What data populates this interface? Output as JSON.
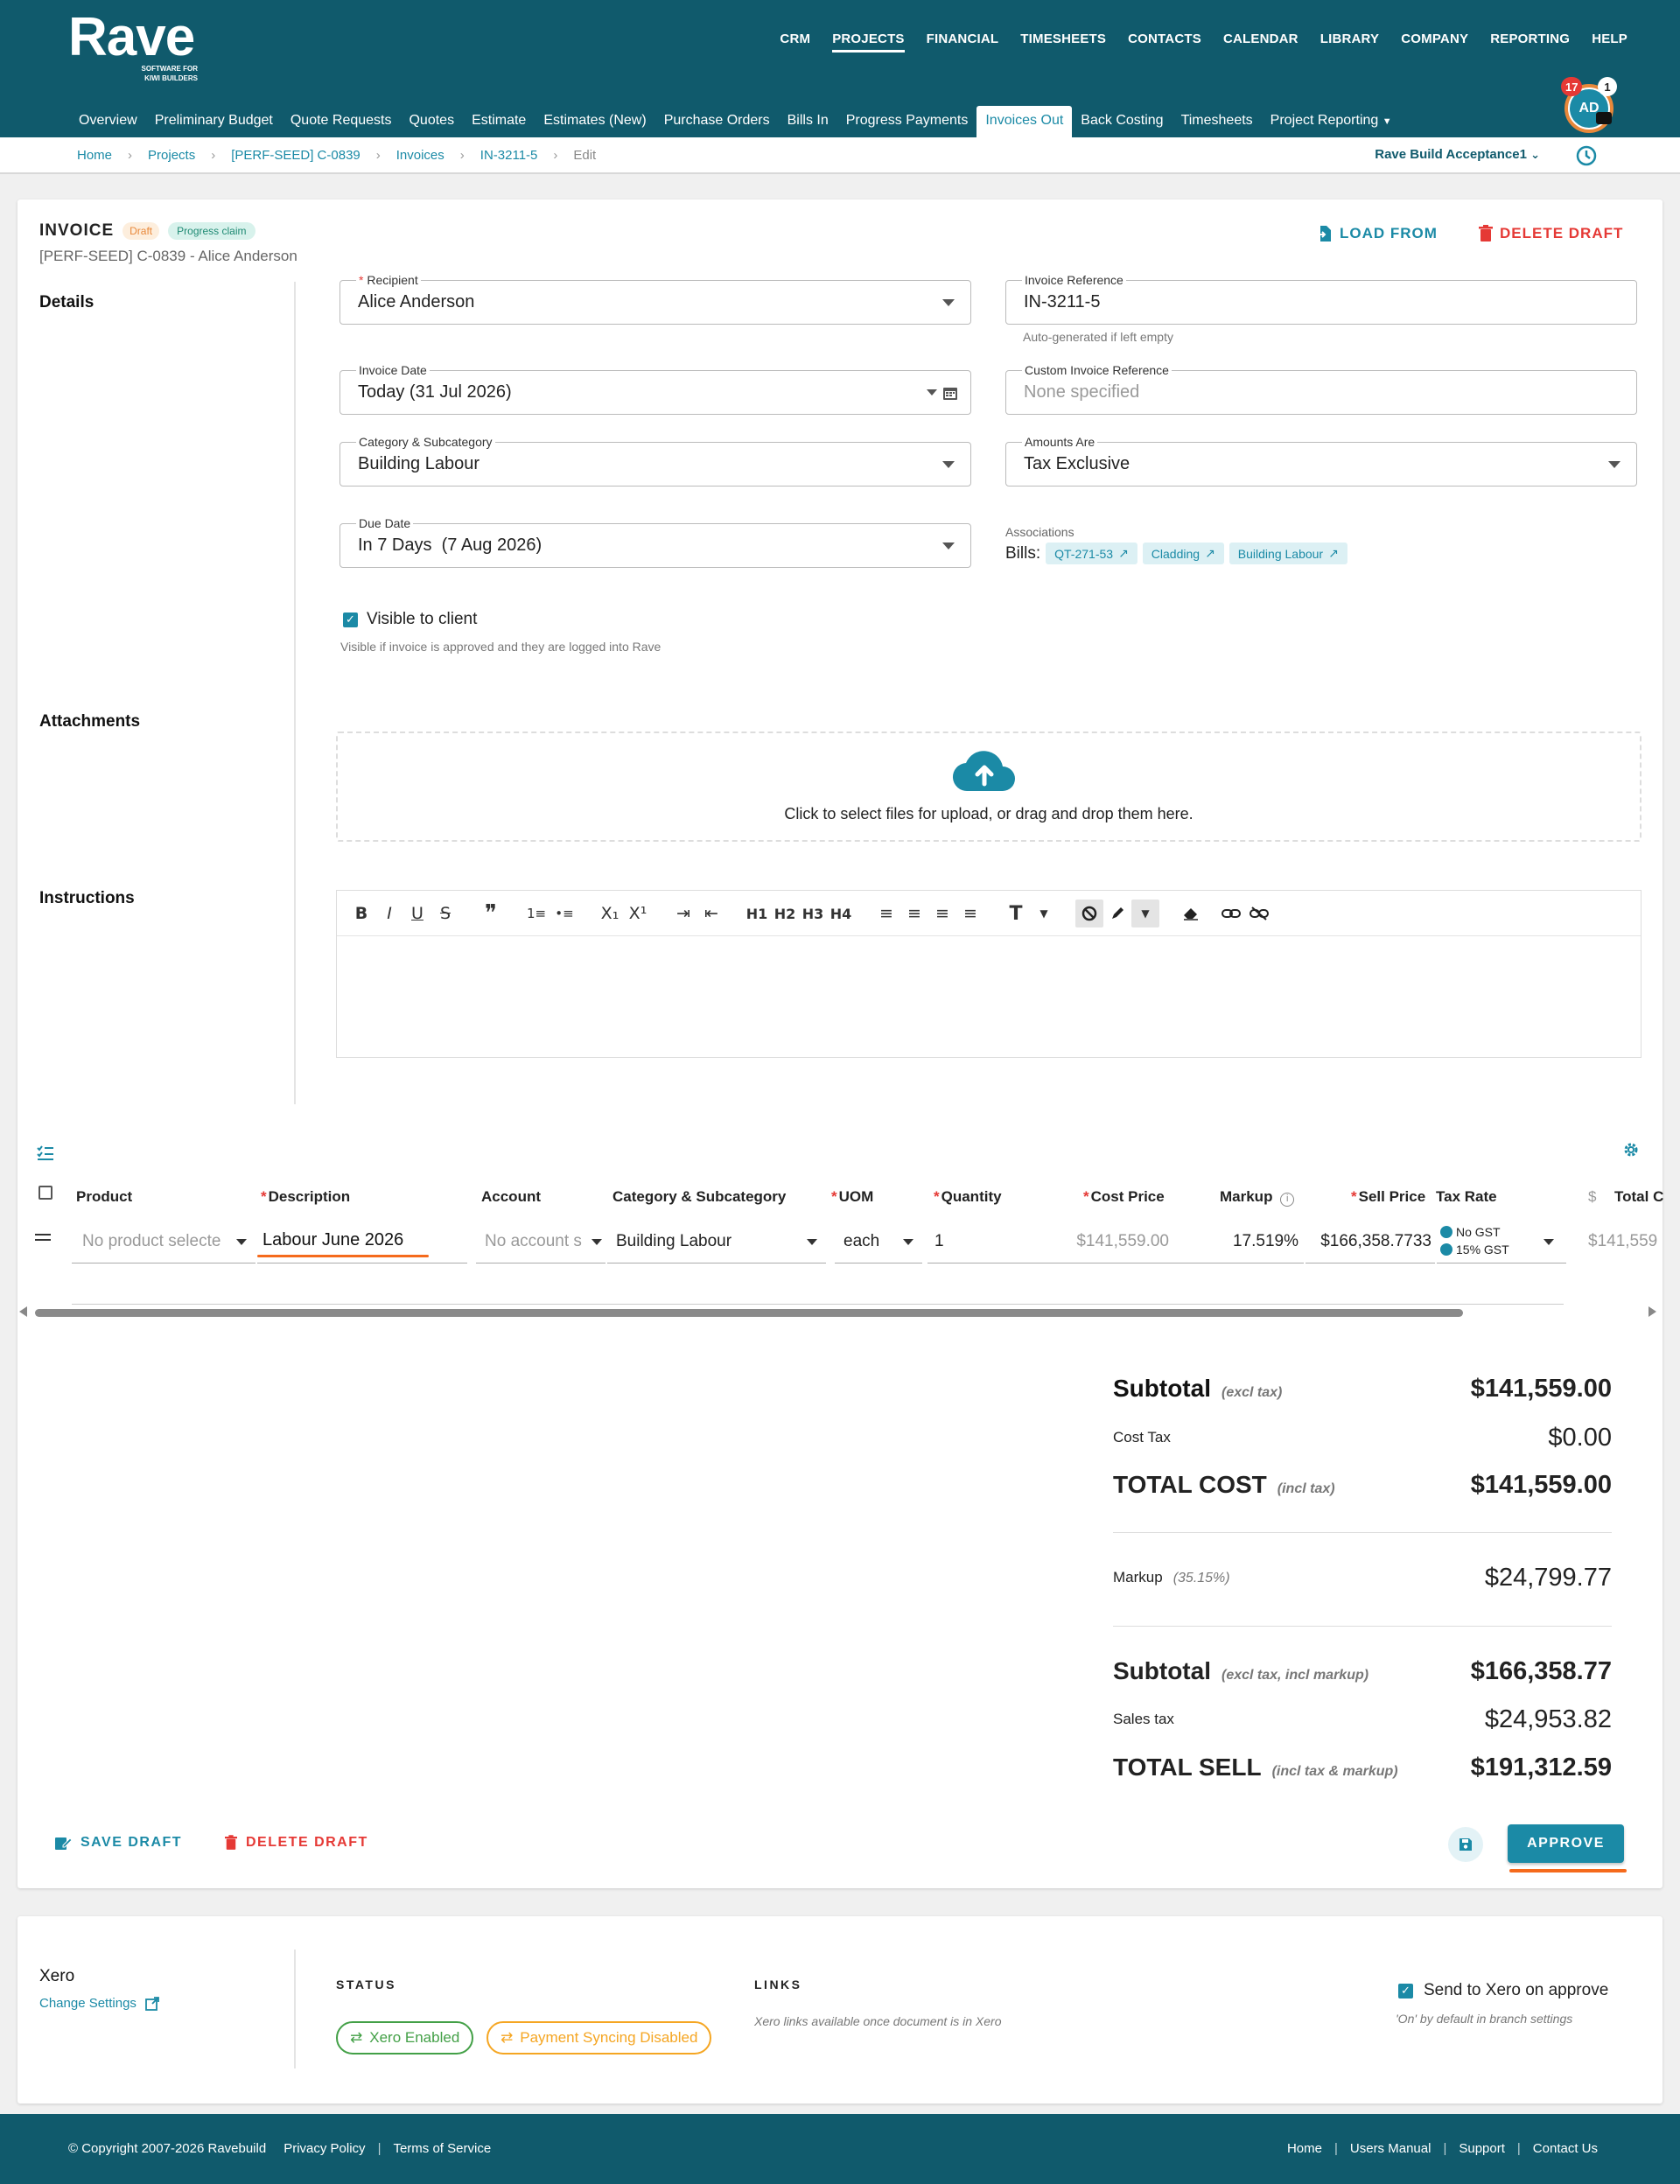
{
  "app": {
    "logo_text": "Rave",
    "logo_tagline_1": "SOFTWARE FOR",
    "logo_tagline_2": "KIWI BUILDERS"
  },
  "main_nav": [
    "CRM",
    "PROJECTS",
    "FINANCIAL",
    "TIMESHEETS",
    "CONTACTS",
    "CALENDAR",
    "LIBRARY",
    "COMPANY",
    "REPORTING",
    "HELP"
  ],
  "sub_nav": [
    "Overview",
    "Preliminary Budget",
    "Quote Requests",
    "Quotes",
    "Estimate",
    "Estimates (New)",
    "Purchase Orders",
    "Bills In",
    "Progress Payments",
    "Invoices Out",
    "Back Costing",
    "Timesheets",
    "Project Reporting"
  ],
  "user": {
    "initials": "AD",
    "notif_count": "17",
    "msg_count": "1"
  },
  "breadcrumb": [
    "Home",
    "Projects",
    "[PERF-SEED] C-0839",
    "Invoices",
    "IN-3211-5",
    "Edit"
  ],
  "branch": "Rave Build Acceptance1",
  "invoice": {
    "title": "INVOICE",
    "status_badge": "Draft",
    "type_badge": "Progress claim",
    "subtitle": "[PERF-SEED] C-0839 - Alice Anderson",
    "load_from": "LOAD FROM",
    "delete_draft": "DELETE DRAFT"
  },
  "details": {
    "section_label": "Details",
    "recipient_label": "Recipient",
    "recipient_value": "Alice Anderson",
    "invoice_ref_label": "Invoice Reference",
    "invoice_ref_value": "IN-3211-5",
    "invoice_ref_helper": "Auto-generated if left empty",
    "invoice_date_label": "Invoice Date",
    "invoice_date_value": "Today (31 Jul 2026)",
    "custom_ref_label": "Custom Invoice Reference",
    "custom_ref_placeholder": "None specified",
    "category_label": "Category & Subcategory",
    "category_value": "Building Labour",
    "amounts_label": "Amounts Are",
    "amounts_value": "Tax Exclusive",
    "due_date_label": "Due Date",
    "due_date_value": "In 7 Days  (7 Aug 2026)",
    "associations_label": "Associations",
    "bills_label": "Bills:",
    "bill_chips": [
      "QT-271-53",
      "Cladding",
      "Building Labour"
    ],
    "visible_label": "Visible to client",
    "visible_helper": "Visible if invoice is approved and they are logged into Rave"
  },
  "attachments": {
    "section_label": "Attachments",
    "drop_text": "Click to select files for upload, or drag and drop them here."
  },
  "instructions": {
    "section_label": "Instructions",
    "toolbar": [
      "B",
      "I",
      "U",
      "S",
      "❞",
      "1≡",
      "•≡",
      "X₁",
      "X¹",
      "⇥",
      "⇤",
      "H1",
      "H2",
      "H3",
      "H4",
      "≡",
      "≡",
      "≡",
      "≡",
      "T"
    ]
  },
  "table": {
    "headers": {
      "product": "Product",
      "description": "Description",
      "account": "Account",
      "category": "Category & Subcategory",
      "uom": "UOM",
      "quantity": "Quantity",
      "cost_price": "Cost Price",
      "markup": "Markup",
      "sell_price": "Sell Price",
      "tax_rate": "Tax Rate",
      "currency": "$",
      "total": "Total C"
    },
    "row": {
      "product": "No product selecte",
      "description": "Labour June 2026",
      "account": "No account s",
      "category": "Building Labour",
      "uom": "each",
      "quantity": "1",
      "cost_price": "$141,559.00",
      "markup": "17.519%",
      "sell_price": "$166,358.7733",
      "tax_1": "No GST",
      "tax_2": "15% GST",
      "total": "$141,559"
    }
  },
  "totals": {
    "subtotal_label": "Subtotal",
    "subtotal_note": "(excl tax)",
    "subtotal_value": "$141,559.00",
    "cost_tax_label": "Cost Tax",
    "cost_tax_value": "$0.00",
    "total_cost_label": "TOTAL COST",
    "total_cost_note": "(incl tax)",
    "total_cost_value": "$141,559.00",
    "markup_label": "Markup",
    "markup_note": "(35.15%)",
    "markup_value": "$24,799.77",
    "subtotal2_label": "Subtotal",
    "subtotal2_note": "(excl tax, incl markup)",
    "subtotal2_value": "$166,358.77",
    "sales_tax_label": "Sales tax",
    "sales_tax_value": "$24,953.82",
    "total_sell_label": "TOTAL SELL",
    "total_sell_note": "(incl tax & markup)",
    "total_sell_value": "$191,312.59"
  },
  "actions": {
    "save_draft": "SAVE DRAFT",
    "delete_draft": "DELETE DRAFT",
    "approve": "APPROVE"
  },
  "xero": {
    "title": "Xero",
    "change_settings": "Change Settings",
    "status_label": "STATUS",
    "links_label": "LINKS",
    "enabled_pill": "Xero Enabled",
    "payment_pill": "Payment Syncing Disabled",
    "links_note": "Xero links available once document is in Xero",
    "send_label": "Send to Xero on approve",
    "send_note": "'On' by default in branch settings"
  },
  "footer": {
    "copyright": "© Copyright 2007-2026 Ravebuild",
    "privacy": "Privacy Policy",
    "terms": "Terms of Service",
    "links": [
      "Home",
      "Users Manual",
      "Support",
      "Contact Us"
    ]
  },
  "colors": {
    "brand": "#105a6c",
    "accent": "#1b8aa6",
    "danger": "#e53935",
    "warning": "#f5a623",
    "success": "#43a047"
  }
}
